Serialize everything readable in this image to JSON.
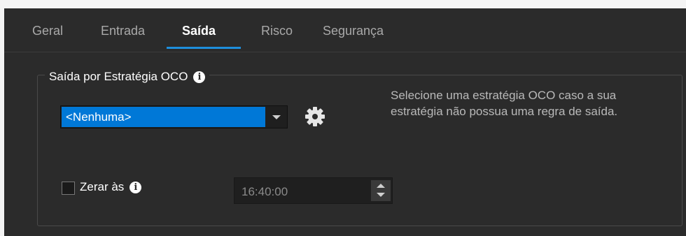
{
  "tabs": [
    {
      "label": "Geral",
      "active": false
    },
    {
      "label": "Entrada",
      "active": false
    },
    {
      "label": "Saída",
      "active": true
    },
    {
      "label": "Risco",
      "active": false
    },
    {
      "label": "Segurança",
      "active": false
    }
  ],
  "oco_group": {
    "title": "Saída por Estratégia OCO",
    "info_icon": "info-icon",
    "strategy_select": {
      "selected": "<Nenhuma>"
    },
    "settings_icon": "gear-icon",
    "help_text": "Selecione uma estratégia OCO caso a sua estratégia não possua uma regra de saída."
  },
  "reset": {
    "checkbox_checked": false,
    "label": "Zerar às",
    "info_icon": "info-icon",
    "time_value": "16:40:00"
  },
  "colors": {
    "accent": "#1e8fdc",
    "selection": "#0078d7",
    "background": "#2b2b2b"
  }
}
